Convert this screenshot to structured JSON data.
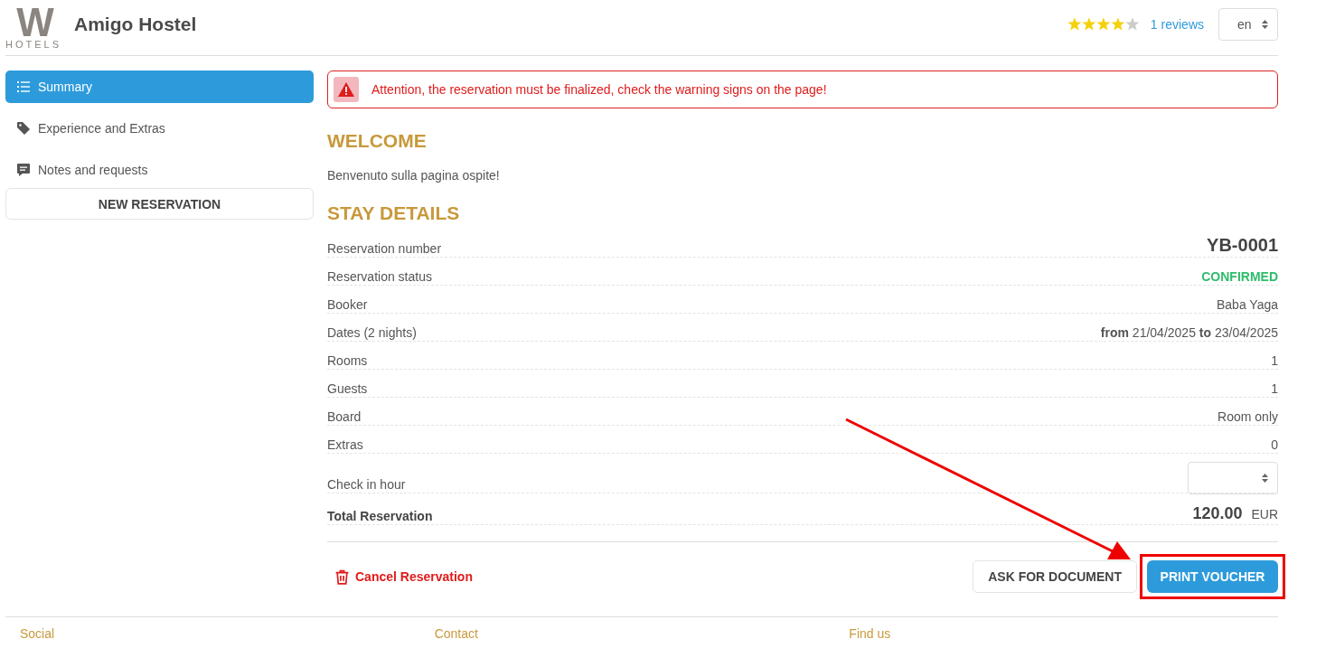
{
  "header": {
    "logo_word": "W",
    "logo_sub": "HOTELS",
    "title": "Amigo Hostel",
    "stars": 4,
    "reviews": "1 reviews",
    "language": "en"
  },
  "sidebar": {
    "items": [
      {
        "label": "Summary",
        "selected": true
      },
      {
        "label": "Experience and Extras",
        "selected": false
      },
      {
        "label": "Notes and requests",
        "selected": false
      }
    ],
    "new_button": "NEW RESERVATION"
  },
  "alert": "Attention, the reservation must be finalized, check the warning signs on the page!",
  "welcome": {
    "heading": "WELCOME",
    "text": "Benvenuto sulla pagina ospite!"
  },
  "stay": {
    "heading": "STAY DETAILS",
    "rows": [
      {
        "label": "Reservation number",
        "value": "YB-0001",
        "kind": "large"
      },
      {
        "label": "Reservation status",
        "value": "CONFIRMED",
        "kind": "status"
      },
      {
        "label": "Booker",
        "value": "Baba Yaga",
        "kind": "text"
      },
      {
        "label": "Dates (2 nights)",
        "value": "**from** 21/04/2025 **to** 23/04/2025",
        "kind": "text"
      },
      {
        "label": "Rooms",
        "value": "1",
        "kind": "text"
      },
      {
        "label": "Guests",
        "value": "1",
        "kind": "text"
      },
      {
        "label": "Board",
        "value": "Room only",
        "kind": "text"
      },
      {
        "label": "Extras",
        "value": "0",
        "kind": "text"
      },
      {
        "label": "Check in hour",
        "kind": "select"
      },
      {
        "label": "Total Reservation",
        "value": "120.00",
        "currency": "EUR",
        "kind": "total"
      }
    ]
  },
  "actions": {
    "cancel": "Cancel Reservation",
    "ask": "ASK FOR DOCUMENT",
    "print": "PRINT VOUCHER"
  },
  "footer": {
    "columns": [
      "Social",
      "Contact",
      "Find us"
    ]
  }
}
